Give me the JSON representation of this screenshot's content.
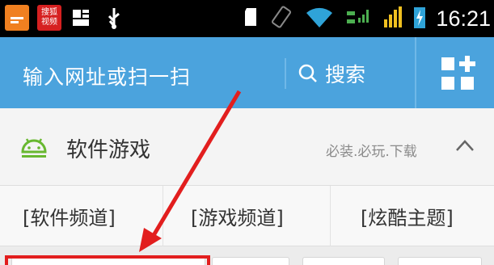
{
  "status_bar": {
    "app_icons": [
      {
        "icon": "orange-app-icon"
      },
      {
        "icon": "sohu-video-icon",
        "label_line1": "搜狐",
        "label_line2": "视频"
      },
      {
        "icon": "wifi-app-icon"
      },
      {
        "icon": "usb-icon"
      }
    ],
    "time": "16:21"
  },
  "url_bar": {
    "input_placeholder": "输入网址或扫一扫",
    "search_label": "搜索"
  },
  "section": {
    "title": "软件游戏",
    "subtitle": "必装.必玩.下载"
  },
  "channels": [
    {
      "label": "[软件频道]"
    },
    {
      "label": "[游戏频道]"
    },
    {
      "label": "[炫酷主题]"
    }
  ],
  "colors": {
    "url_bar": "#4ba3dd",
    "android_green": "#68b830",
    "annotation_red": "#e21e1e"
  }
}
